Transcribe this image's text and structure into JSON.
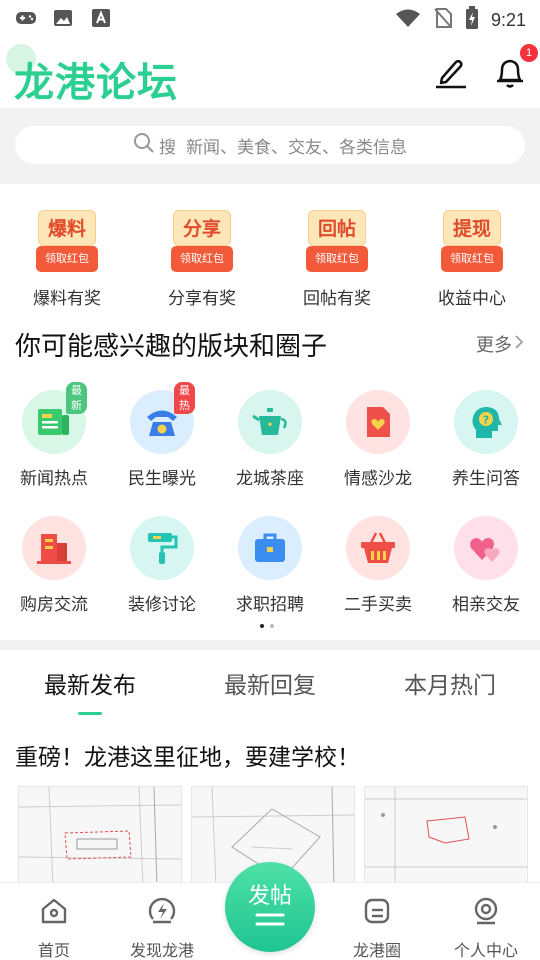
{
  "status": {
    "time": "9:21"
  },
  "header": {
    "title": "龙港论坛",
    "notification_count": "1"
  },
  "search": {
    "icon_label": "搜",
    "placeholder": "新闻、美食、交友、各类信息"
  },
  "rewards": [
    {
      "badge": "爆料",
      "sub": "领取红包",
      "label": "爆料有奖"
    },
    {
      "badge": "分享",
      "sub": "领取红包",
      "label": "分享有奖"
    },
    {
      "badge": "回帖",
      "sub": "领取红包",
      "label": "回帖有奖"
    },
    {
      "badge": "提现",
      "sub": "领取红包",
      "label": "收益中心"
    }
  ],
  "section": {
    "title": "你可能感兴趣的版块和圈子",
    "more": "更多"
  },
  "forums": [
    {
      "label": "新闻热点",
      "badge": "最新",
      "icon": "newspaper-icon",
      "bg": "#d9f7e6",
      "color": "#39c96e"
    },
    {
      "label": "民生曝光",
      "badge": "最热",
      "icon": "phone-icon",
      "bg": "#dbeeff",
      "color": "#3a7de8"
    },
    {
      "label": "龙城茶座",
      "icon": "teapot-icon",
      "bg": "#d8f6ee",
      "color": "#26b99a"
    },
    {
      "label": "情感沙龙",
      "icon": "heart-letter-icon",
      "bg": "#ffe3e3",
      "color": "#f0504a"
    },
    {
      "label": "养生问答",
      "icon": "head-question-icon",
      "bg": "#d7f6f2",
      "color": "#1fb7a8"
    },
    {
      "label": "购房交流",
      "icon": "building-icon",
      "bg": "#ffe3e1",
      "color": "#ef4e46"
    },
    {
      "label": "装修讨论",
      "icon": "paint-roller-icon",
      "bg": "#d7f6f2",
      "color": "#23c4b4"
    },
    {
      "label": "求职招聘",
      "icon": "briefcase-icon",
      "bg": "#dbeeff",
      "color": "#3b8ef0"
    },
    {
      "label": "二手买卖",
      "icon": "basket-icon",
      "bg": "#ffe3e1",
      "color": "#ef4e46"
    },
    {
      "label": "相亲交友",
      "icon": "hearts-icon",
      "bg": "#ffe0ea",
      "color": "#f0608a"
    }
  ],
  "tabs": [
    "最新发布",
    "最新回复",
    "本月热门"
  ],
  "post": {
    "title": "重磅！龙港这里征地，要建学校！"
  },
  "nav": {
    "home": "首页",
    "discover": "发现龙港",
    "post": "发帖",
    "circle": "龙港圈",
    "profile": "个人中心"
  },
  "colors": {
    "accent": "#2ccf92",
    "badge_red": "#f3323b",
    "reward_red": "#f25a3a"
  }
}
